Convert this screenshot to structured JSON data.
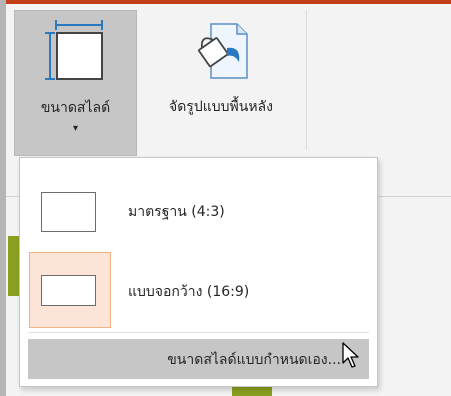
{
  "ribbon": {
    "slide_size": {
      "label": "ขนาดสไลด์",
      "dropdown_arrow": "▾",
      "icon": "slide-size-icon"
    },
    "format_background": {
      "label": "จัดรูปแบบพื้นหลัง",
      "icon": "format-background-icon"
    }
  },
  "menu": {
    "items": [
      {
        "label": "มาตรฐาน (4:3)",
        "icon": "standard-slide-icon"
      },
      {
        "label": "แบบจอกว้าง (16:9)",
        "icon": "widescreen-slide-icon",
        "selected": true
      },
      {
        "label": "ขนาดสไลด์แบบกำหนดเอง...",
        "hovered": true
      }
    ]
  },
  "colors": {
    "accent": "#c43e1c",
    "selected_fill": "#fce4d6",
    "selected_border": "#f4b183",
    "hover_fill": "#c6c6c6"
  }
}
